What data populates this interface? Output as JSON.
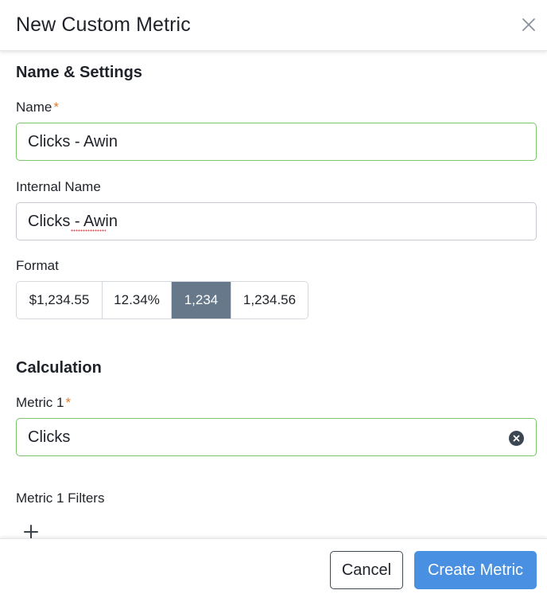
{
  "modal": {
    "title": "New Custom Metric",
    "close_icon": "close-icon"
  },
  "name_settings": {
    "section_title": "Name & Settings",
    "name_label": "Name",
    "required_marker": "*",
    "name_value": "Clicks - Awin",
    "internal_name_label": "Internal Name",
    "internal_name_value": "Clicks - Awin",
    "format_label": "Format",
    "format_options": [
      "$1,234.55",
      "12.34%",
      "1,234",
      "1,234.56"
    ],
    "format_selected": "1,234"
  },
  "calculation": {
    "section_title": "Calculation",
    "metric1_label": "Metric 1",
    "required_marker": "*",
    "metric1_value": "Clicks",
    "metric1_filters_label": "Metric 1 Filters",
    "clear_icon": "clear-circle-icon",
    "add_icon": "plus-icon"
  },
  "footer": {
    "cancel_label": "Cancel",
    "create_label": "Create Metric"
  },
  "colors": {
    "primary_button": "#4a90e2",
    "selected_format": "#66788a",
    "valid_border": "#7cc36b",
    "required": "#e07b2c"
  }
}
